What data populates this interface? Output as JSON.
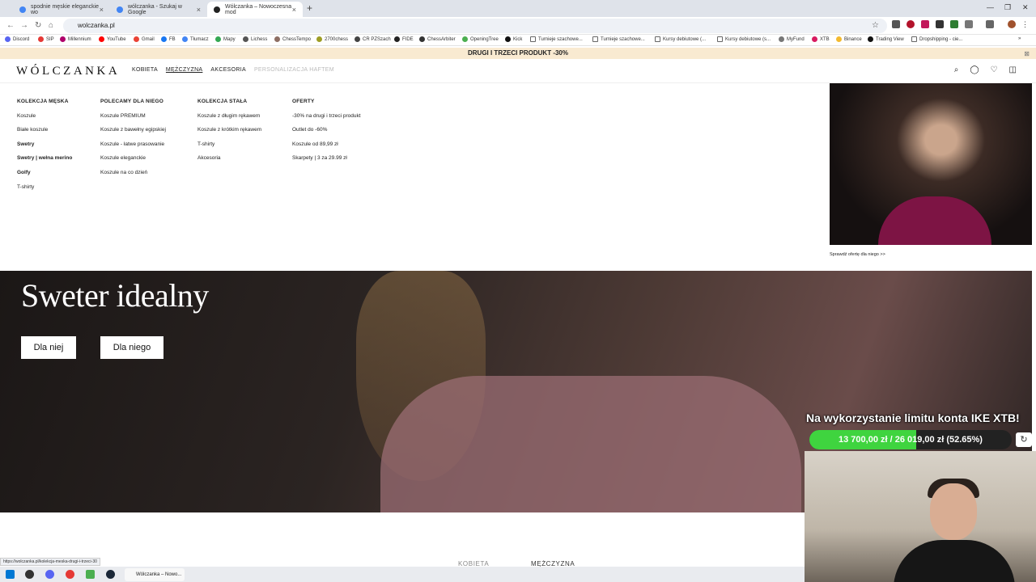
{
  "browser": {
    "tabs": [
      {
        "title": "spodnie męskie eleganckie wo"
      },
      {
        "title": "wólczanka - Szukaj w Google"
      },
      {
        "title": "Wólczanka – Nowoczesna mod"
      }
    ],
    "new_tab": "+",
    "url": "wolczanka.pl",
    "bookmarks": [
      "Discord",
      "SIP",
      "Millennium",
      "YouTube",
      "Gmail",
      "FB",
      "Tłumacz",
      "Mapy",
      "Lichess",
      "ChessTempo",
      "2700chess",
      "CR PZSzach",
      "FIDE",
      "ChessArbiter",
      "OpeningTree",
      "Kick",
      "Turnieje szachowe...",
      "Turnieje szachowe...",
      "Kursy debiutowe (...",
      "Kursy debiutowe (s...",
      "MyFund",
      "XTB",
      "Binance",
      "Trading View",
      "Dropshipping - cie..."
    ],
    "status_url": "https://wolczanka.pl/kolekcja-meska-drugi-i-trzeci-30"
  },
  "promo_bar": {
    "text": "DRUGI I TRZECI PRODUKT -30%"
  },
  "header": {
    "logo": "WÓLCZANKA",
    "nav": [
      "KOBIETA",
      "MĘŻCZYZNA",
      "AKCESORIA",
      "PERSONALIZACJA HAFTEM"
    ]
  },
  "mega_menu": {
    "columns": [
      {
        "title": "KOLEKCJA MĘSKA",
        "items": [
          "Koszule",
          "Białe koszule",
          "Swetry",
          "Swetry | wełna merino",
          "Golfy",
          "T-shirty"
        ]
      },
      {
        "title": "POLECAMY DLA NIEGO",
        "items": [
          "Koszule PREMIUM",
          "Koszule z bawełny egipskiej",
          "Koszule - łatwe prasowanie",
          "Koszule eleganckie",
          "Koszule na co dzień"
        ]
      },
      {
        "title": "KOLEKCJA STAŁA",
        "items": [
          "Koszule z długim rękawem",
          "Koszule z krótkim rękawem",
          "T-shirty",
          "Akcesoria"
        ]
      },
      {
        "title": "OFERTY",
        "items": [
          "-30% na drugi i trzeci produkt",
          "Outlet do -60%",
          "Koszule od 89,99 zł",
          "Skarpety | 3 za 29.99 zł"
        ]
      }
    ],
    "promo_link": "Sprawdź ofertę dla niego >>"
  },
  "hero": {
    "title": "Sweter idealny",
    "buttons": [
      "Dla niej",
      "Dla niego"
    ]
  },
  "overlay": {
    "title": "Na wykorzystanie limitu konta IKE XTB!",
    "progress_text": "13 700,00 zł / 26 019,00 zł (52.65%)",
    "progress_fraction": 0.5265,
    "accent": "#3fd43f"
  },
  "bottom_categories": [
    "KOBIETA",
    "MĘŻCZYZNA"
  ],
  "taskbar": {
    "app_label": "Wólczanka – Nowo..."
  }
}
